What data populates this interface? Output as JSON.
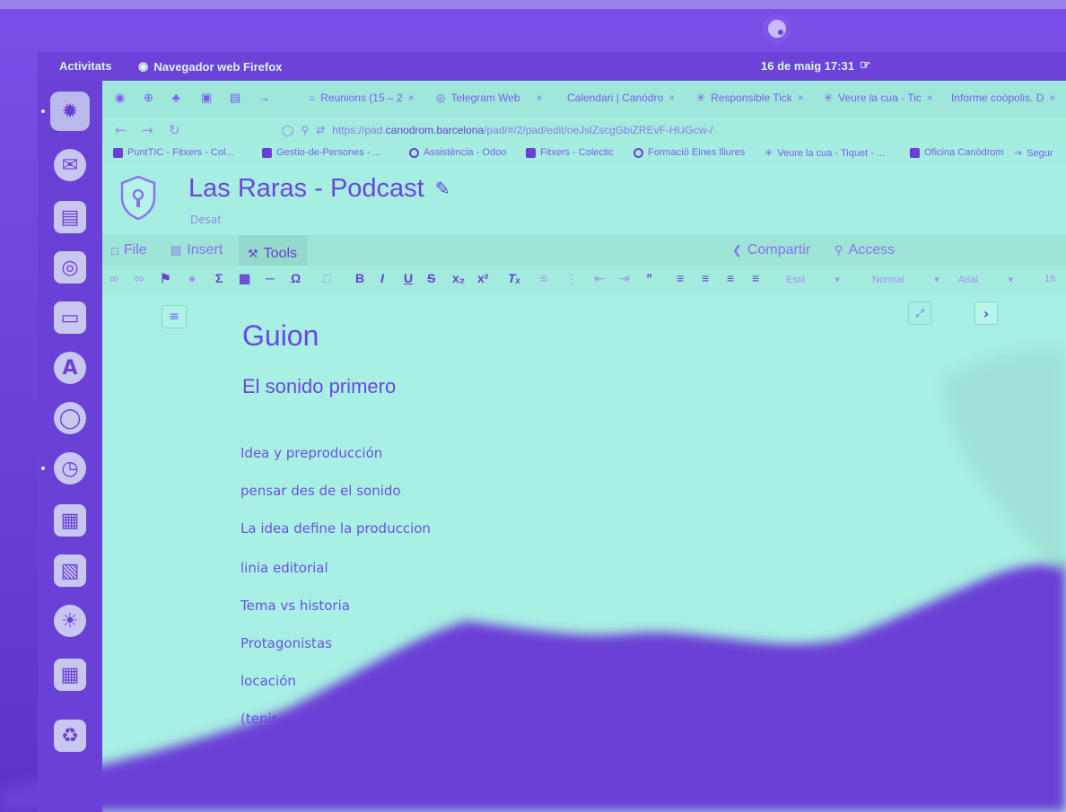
{
  "topbar": {
    "activities": "Activitats",
    "app_name": "Navegador web Firefox",
    "clock": "16 de maig  17:31"
  },
  "dock": {
    "items": [
      "firefox-icon",
      "thunderbird-icon",
      "writer-icon",
      "rhythmbox-icon",
      "files-icon",
      "software-icon",
      "chromium-icon",
      "timeshift-icon",
      "calc-icon",
      "impress-icon",
      "screenshot-icon",
      "show-apps-icon",
      "trash-icon"
    ]
  },
  "tabs": [
    {
      "label": "Reunions (15 – 2",
      "close": "×"
    },
    {
      "label": "Telegram Web",
      "close": "×"
    },
    {
      "label": "Calendari | Canòdro",
      "close": "×"
    },
    {
      "label": "Responsible Tick",
      "close": "×"
    },
    {
      "label": "Veure la cua - Tic",
      "close": "×"
    },
    {
      "label": "Informe coòpolis. D",
      "close": "×"
    }
  ],
  "url": {
    "prefix": "https://pad.",
    "domain": "canodrom.barcelona",
    "path": "/pad/#/2/pad/edit/oeJslZscgGbiZREvF-HUGcw-/"
  },
  "bookmarks": [
    "PuntTIC - Fitxers - Col...",
    "Gestio-de-Persones - ...",
    "Assistència - Odoo",
    "Fitxers - Colectic",
    "Formació Eines lliures",
    "Veure la cua - Tiquet - ...",
    "Oficina Canòdrom",
    "Segur"
  ],
  "pad": {
    "title": "Las Raras - Podcast",
    "status": "Desat"
  },
  "menu": {
    "file": "File",
    "insert": "Insert",
    "tools": "Tools",
    "share": "Compartir",
    "access": "Access"
  },
  "toolbar": {
    "style_label": "Estil",
    "format_label": "Normal",
    "font_label": "Arial",
    "size_label": "16"
  },
  "document": {
    "heading1": "Guion",
    "heading2": "El sonido primero",
    "paragraphs": [
      "Idea y preproducción",
      "pensar des de el sonido",
      "La idea define la produccion",
      "linia editorial",
      "Tema vs historia",
      "Protagonistas",
      "locación",
      "(tenir"
    ]
  },
  "colors": {
    "tint_purple": "#6a3fd6",
    "tint_mint": "#a5ede0"
  }
}
